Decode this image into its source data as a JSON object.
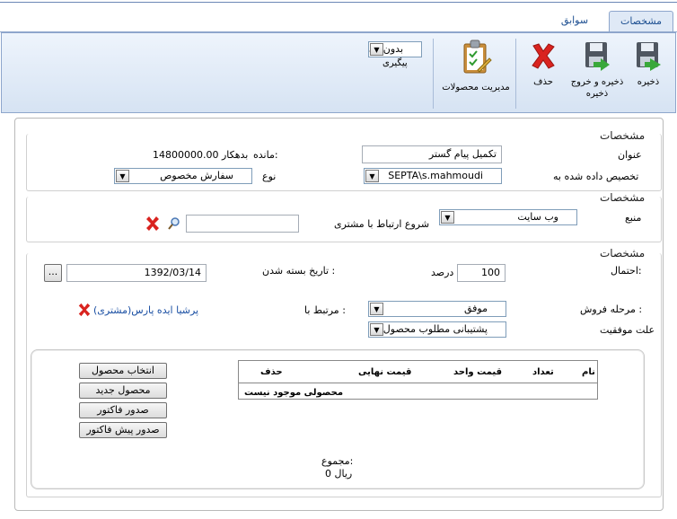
{
  "tabs": [
    {
      "label": "مشخصات",
      "active": true
    },
    {
      "label": "سوابق",
      "active": false
    }
  ],
  "ribbon": {
    "save": "ذخیره",
    "save_exit": "ذخیره و خروج",
    "save_exit_2": "ذخیره",
    "delete": "حذف",
    "manage_products": "مدیریت محصولات",
    "followup_select": "بدون پی",
    "followup_label": "پیگیری"
  },
  "section1": {
    "title": "مشخصات",
    "subject_label": "عنوان",
    "subject_value": "تکمیل پیام گستر",
    "assigned_label": "تخصیص داده شده به",
    "assigned_value": "SEPTA\\s.mahmoudi",
    "balance_label": "مانده:",
    "balance_value": "14800000.00 بدهکار",
    "type_label": "نوع",
    "type_value": "سفارش مخصوص"
  },
  "section2": {
    "title": "مشخصات",
    "source_label": "منبع",
    "source_value": "وب سایت",
    "customer_label": "شروع ارتباط با مشتری",
    "customer_value": ""
  },
  "section3": {
    "title": "مشخصات",
    "probability_label": "احتمال:",
    "probability_value": "100",
    "percent_label": "درصد",
    "close_date_label": "تاریخ بسته شدن :",
    "close_date_value": "1392/03/14",
    "ellipsis": "...",
    "stage_label": "مرحله فروش :",
    "stage_value": "موفق",
    "related_label": "مرتبط با :",
    "related_value": "پرشیا ایده پارس(مشتری)",
    "reason_label": "علت موفقیت",
    "reason_value": "پشتیبانی مطلوب محصول"
  },
  "products": {
    "columns": [
      "نام",
      "تعداد",
      "قیمت واحد",
      "قیمت نهایی",
      "حذف"
    ],
    "empty_text": "محصولی موجود نیست",
    "buttons": [
      "انتخاب محصول",
      "محصول جدید",
      "صدور فاکتور",
      "صدور پیش فاکتور"
    ],
    "total_label": "مجموع:",
    "total_value": "0 ریال"
  }
}
